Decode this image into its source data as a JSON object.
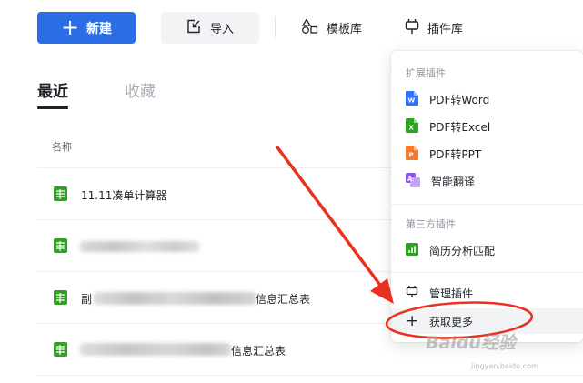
{
  "toolbar": {
    "new_label": "新建",
    "import_label": "导入",
    "templates_label": "模板库",
    "plugins_label": "插件库"
  },
  "tabs": [
    {
      "label": "最近",
      "active": true
    },
    {
      "label": "收藏",
      "active": false
    }
  ],
  "table": {
    "name_header": "名称",
    "rows": [
      {
        "name": "11.11凑单计算器",
        "icon": "sheet-icon"
      },
      {
        "name": "",
        "icon": "sheet-icon",
        "blurred": true
      },
      {
        "name_prefix": "副",
        "name_suffix": "信息汇总表",
        "icon": "sheet-icon",
        "blurred": true
      },
      {
        "name_suffix": "信息汇总表",
        "icon": "sheet-icon",
        "blurred": true
      }
    ]
  },
  "plugin_menu": {
    "extension_section": "扩展插件",
    "extensions": [
      {
        "label": "PDF转Word",
        "icon": "word-icon",
        "color": "#3370ff"
      },
      {
        "label": "PDF转Excel",
        "icon": "excel-icon",
        "color": "#2ea121"
      },
      {
        "label": "PDF转PPT",
        "icon": "ppt-icon",
        "color": "#f5782f"
      },
      {
        "label": "智能翻译",
        "icon": "translate-icon",
        "color": "#8d55ed"
      }
    ],
    "third_party_section": "第三方插件",
    "third_party": [
      {
        "label": "简历分析匹配",
        "icon": "chart-icon",
        "color": "#2ea121"
      }
    ],
    "manage_label": "管理插件",
    "more_label": "获取更多"
  },
  "colors": {
    "primary": "#2b6de5",
    "annotation": "#e8311f",
    "sheet_green": "#2ea121"
  },
  "watermark": {
    "brand": "Baidu经验",
    "url": "jingyan.baidu.com"
  }
}
